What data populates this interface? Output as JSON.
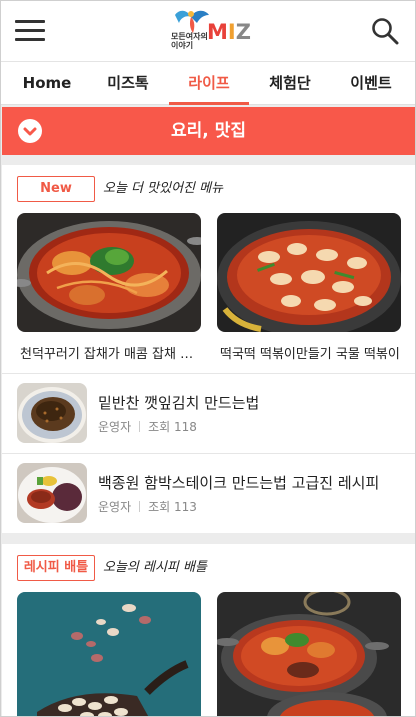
{
  "header": {
    "logo_text_m": "M",
    "logo_text_i": "I",
    "logo_text_z": "Z",
    "logo_sub": "모든여자의 이야기",
    "menu_icon": "hamburger-icon",
    "search_icon": "search-icon"
  },
  "nav": {
    "tabs": [
      {
        "label": "Home"
      },
      {
        "label": "미즈톡"
      },
      {
        "label": "라이프"
      },
      {
        "label": "체험단"
      },
      {
        "label": "이벤트"
      }
    ],
    "active": "라이프"
  },
  "category": {
    "title": "요리, 맛집",
    "toggle_icon": "chevron-down-icon"
  },
  "section_new": {
    "badge": "New",
    "title": "오늘 더 맛있어진 메뉴",
    "cards": [
      {
        "caption": "천덕꾸러기 잡채가 매콤 잡채 변신"
      },
      {
        "caption": "떡국떡 떡볶이만들기 국물 떡볶이"
      }
    ],
    "list": [
      {
        "title": "밑반찬 깻잎김치 만드는법",
        "author": "운영자",
        "views": "조회 118"
      },
      {
        "title": "백종원 함박스테이크 만드는법 고급진 레시피",
        "author": "운영자",
        "views": "조회 113"
      }
    ]
  },
  "section_battle": {
    "badge": "레시피 배틀",
    "title": "오늘의 레시피 배틀"
  },
  "colors": {
    "accent": "#f05a46",
    "category_bar": "#f8584a"
  }
}
